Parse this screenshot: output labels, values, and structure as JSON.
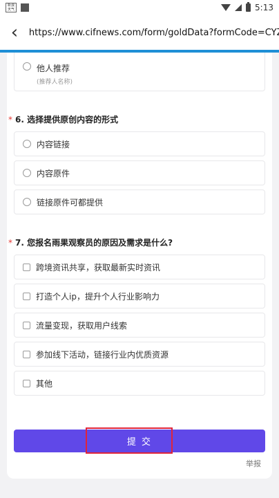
{
  "status_bar": {
    "logo_text": "新浪\n天气",
    "time": "5:13"
  },
  "browser": {
    "url": "https://www.cifnews.com/form/goldData?formCode=CYZ..."
  },
  "form": {
    "partial_option": {
      "label": "他人推荐",
      "hint": "(推荐人名称)"
    },
    "q6": {
      "star": "*",
      "title": "6. 选择提供原创内容的形式",
      "options": [
        "内容链接",
        "内容原件",
        "链接原件可都提供"
      ]
    },
    "q7": {
      "star": "*",
      "title": "7. 您报名雨果观察员的原因及需求是什么?",
      "options": [
        "跨境资讯共享，获取最新实时资讯",
        "打造个人ip，提升个人行业影响力",
        "流量变现，获取用户线索",
        "参加线下活动，链接行业内优质资源",
        "其他"
      ]
    },
    "submit_label": "提 交",
    "report_label": "举报"
  }
}
